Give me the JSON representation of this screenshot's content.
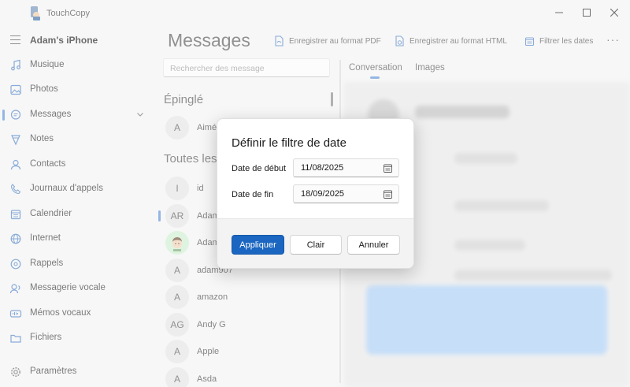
{
  "window": {
    "app_title": "TouchCopy",
    "minimize_glyph": "—",
    "maximize_glyph": "☐",
    "close_glyph": "✕"
  },
  "sidebar": {
    "device_name": "Adam's iPhone",
    "items": [
      {
        "label": "Musique",
        "icon": "music-note-icon"
      },
      {
        "label": "Photos",
        "icon": "image-icon"
      },
      {
        "label": "Messages",
        "icon": "chat-bubble-icon",
        "active": true
      },
      {
        "label": "Notes",
        "icon": "notes-icon"
      },
      {
        "label": "Contacts",
        "icon": "person-icon"
      },
      {
        "label": "Journaux d'appels",
        "icon": "phone-icon"
      },
      {
        "label": "Calendrier",
        "icon": "calendar-icon"
      },
      {
        "label": "Internet",
        "icon": "globe-icon"
      },
      {
        "label": "Rappels",
        "icon": "reminder-icon"
      },
      {
        "label": "Messagerie vocale",
        "icon": "voicemail-icon"
      },
      {
        "label": "Mémos vocaux",
        "icon": "voice-memo-icon"
      },
      {
        "label": "Fichiers",
        "icon": "folder-icon"
      }
    ],
    "settings_label": "Paramètres"
  },
  "main": {
    "title": "Messages",
    "toolbar": {
      "save_pdf": "Enregistrer au format PDF",
      "save_html": "Enregistrer au format HTML",
      "filter_dates": "Filtrer les dates",
      "more": "···"
    },
    "search_placeholder": "Rechercher des message",
    "pinned_title": "Épinglé",
    "all_title": "Toutes les",
    "pinned": [
      {
        "initials": "A",
        "name": "Aimé"
      }
    ],
    "contacts": [
      {
        "initials": "I",
        "name": "id"
      },
      {
        "initials": "AR",
        "name": "Adam"
      },
      {
        "initials": "",
        "name": "Adam"
      },
      {
        "initials": "A",
        "name": "adam907"
      },
      {
        "initials": "A",
        "name": "amazon"
      },
      {
        "initials": "AG",
        "name": "Andy G"
      },
      {
        "initials": "A",
        "name": "Apple"
      },
      {
        "initials": "A",
        "name": "Asda"
      }
    ],
    "tabs": [
      "Conversation",
      "Images"
    ]
  },
  "dialog": {
    "title": "Définir le filtre de date",
    "start_label": "Date de début",
    "start_value": "11/08/2025",
    "end_label": "Date de fin",
    "end_value": "18/09/2025",
    "apply_label": "Appliquer",
    "clear_label": "Clair",
    "cancel_label": "Annuler"
  },
  "colors": {
    "accent": "#1a66c1",
    "indicator": "#5a8fd6"
  }
}
